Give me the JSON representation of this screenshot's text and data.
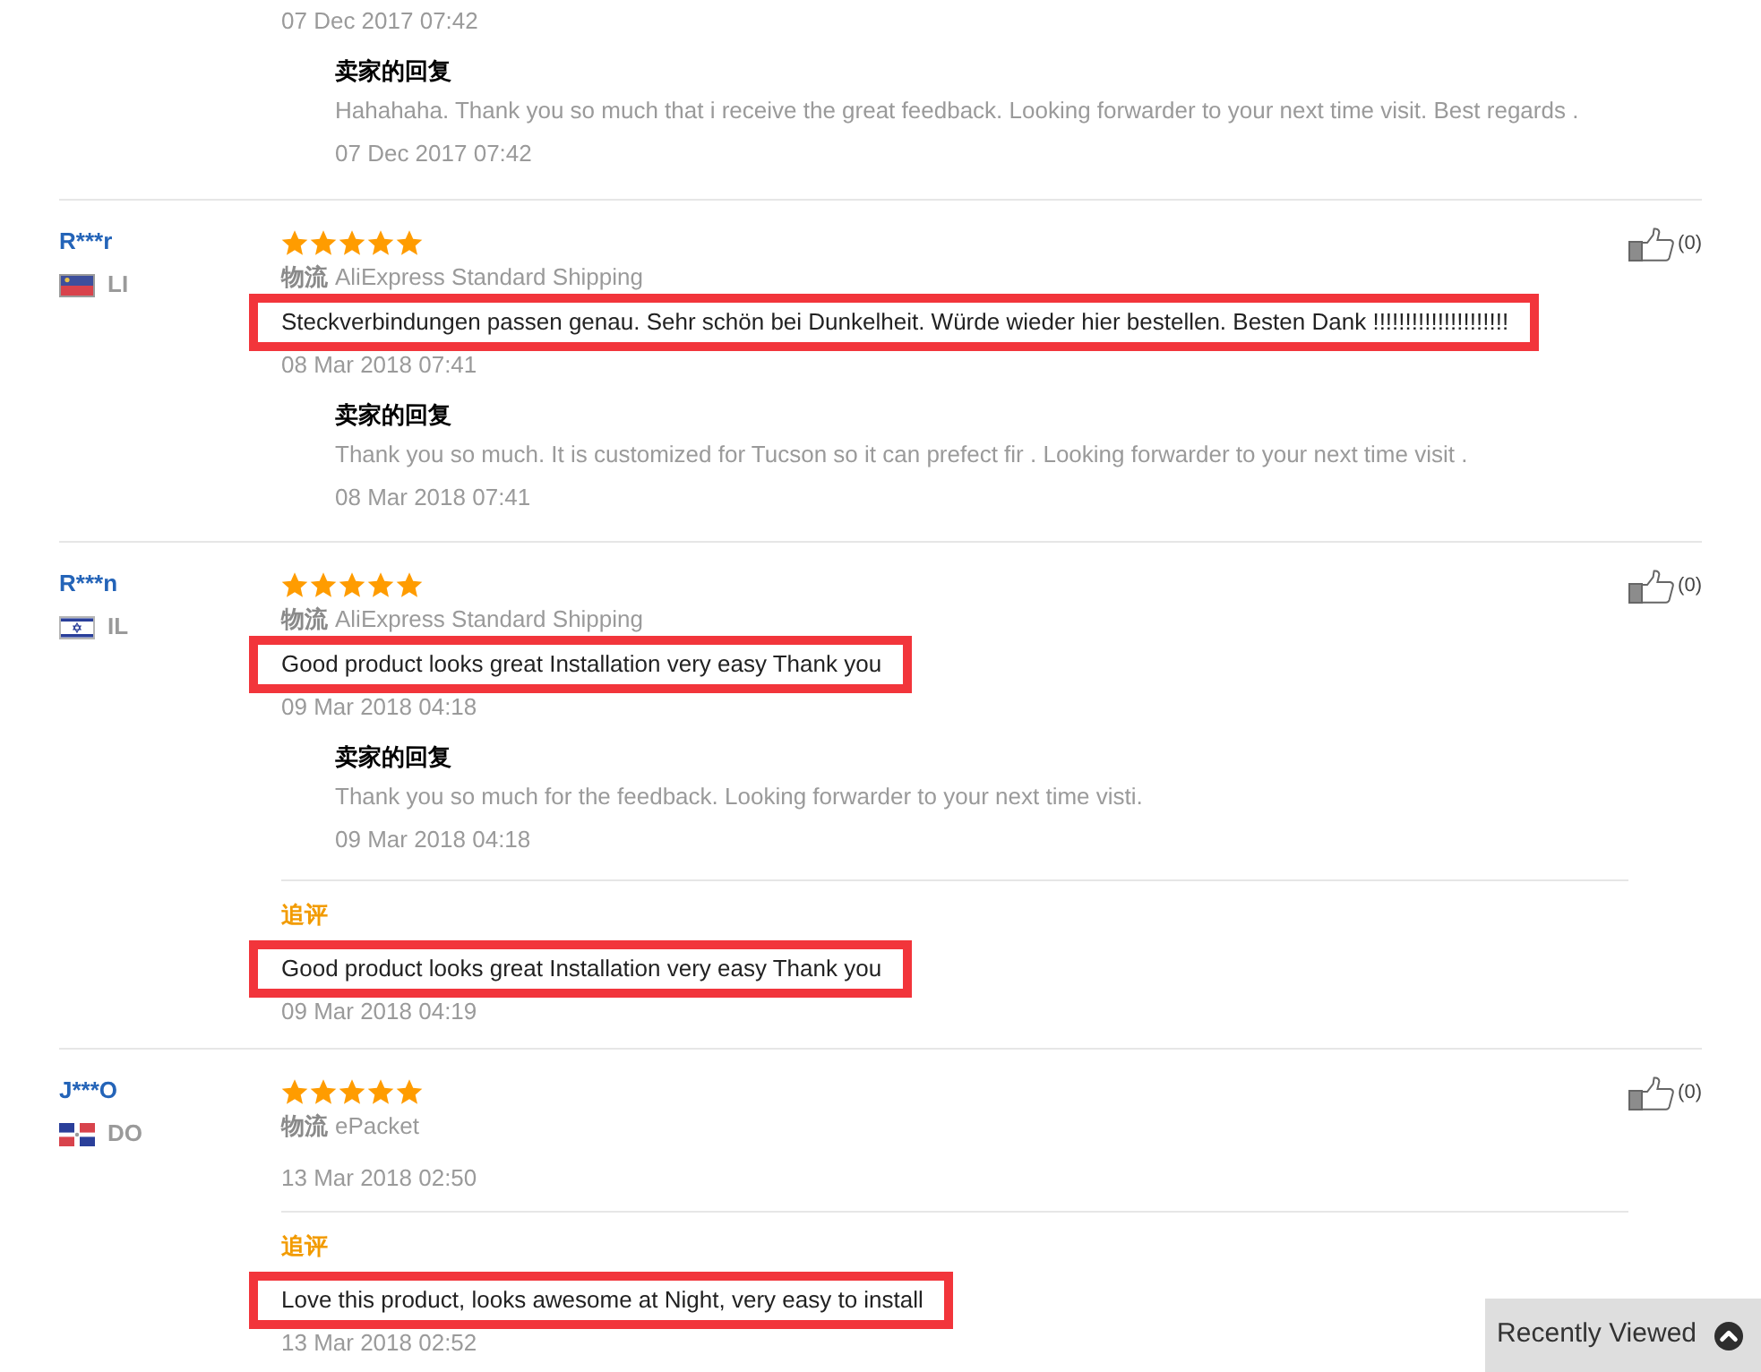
{
  "top_review": {
    "date": "07 Dec 2017 07:42",
    "seller_reply": {
      "heading": "卖家的回复",
      "text": "Hahahaha. Thank you so much that i receive the great feedback. Looking forwarder to your next time visit. Best regards .",
      "date": "07 Dec 2017 07:42"
    }
  },
  "reviews": [
    {
      "user": "R***r",
      "country": {
        "kind": "bicolor",
        "code": "LI"
      },
      "stars": 5,
      "shipping_label": "物流",
      "shipping": "AliExpress Standard Shipping",
      "text": "Steckverbindungen passen genau. Sehr schön bei Dunkelheit. Würde wieder hier bestellen. Besten Dank !!!!!!!!!!!!!!!!!!!!!",
      "highlighted": true,
      "date": "08 Mar 2018 07:41",
      "likes": "(0)",
      "seller_reply": {
        "heading": "卖家的回复",
        "text": "Thank you so much. It is customized for Tucson so it can prefect fir . Looking forwarder to your next time visit .",
        "date": "08 Mar 2018 07:41"
      }
    },
    {
      "user": "R***n",
      "country": {
        "kind": "stripes",
        "code": "IL"
      },
      "stars": 5,
      "shipping_label": "物流",
      "shipping": "AliExpress Standard Shipping",
      "text": "Good product looks great Installation very easy Thank you",
      "highlighted": true,
      "date": "09 Mar 2018 04:18",
      "likes": "(0)",
      "seller_reply": {
        "heading": "卖家的回复",
        "text": "Thank you so much for the feedback. Looking forwarder to your next time visti.",
        "date": "09 Mar 2018 04:18"
      },
      "follow_up": {
        "label": "追评",
        "text": "Good product looks great Installation very easy Thank you",
        "highlighted": true,
        "date": "09 Mar 2018 04:19"
      }
    },
    {
      "user": "J***O",
      "country": {
        "kind": "quartered",
        "code": "DO"
      },
      "stars": 5,
      "shipping_label": "物流",
      "shipping": "ePacket",
      "date": "13 Mar 2018 02:50",
      "likes": "(0)",
      "follow_up": {
        "label": "追评",
        "text": "Love this product, looks awesome at Night, very easy to install",
        "highlighted": true,
        "date": "13 Mar 2018 02:52"
      }
    }
  ],
  "recently_viewed": {
    "label": "Recently Viewed"
  }
}
